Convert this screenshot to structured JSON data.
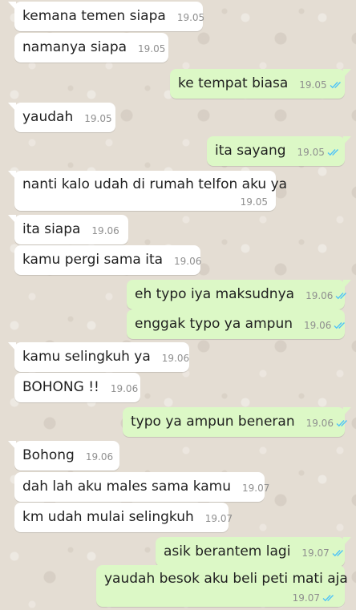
{
  "chat": {
    "messages": [
      {
        "text": "kemana temen siapa",
        "time": "19.05",
        "direction": "in"
      },
      {
        "text": "namanya siapa",
        "time": "19.05",
        "direction": "in"
      },
      {
        "text": "ke tempat biasa",
        "time": "19.05",
        "direction": "out",
        "status": "read"
      },
      {
        "text": "yaudah",
        "time": "19.05",
        "direction": "in"
      },
      {
        "text": "ita sayang",
        "time": "19.05",
        "direction": "out",
        "status": "read"
      },
      {
        "text": "nanti kalo udah di rumah telfon aku ya",
        "time": "19.05",
        "direction": "in"
      },
      {
        "text": "ita siapa",
        "time": "19.06",
        "direction": "in"
      },
      {
        "text": "kamu pergi sama ita",
        "time": "19.06",
        "direction": "in"
      },
      {
        "text": "eh typo iya maksudnya",
        "time": "19.06",
        "direction": "out",
        "status": "read"
      },
      {
        "text": "enggak typo ya ampun",
        "time": "19.06",
        "direction": "out",
        "status": "read"
      },
      {
        "text": "kamu selingkuh ya",
        "time": "19.06",
        "direction": "in"
      },
      {
        "text": "BOHONG !!",
        "time": "19.06",
        "direction": "in"
      },
      {
        "text": "typo ya ampun beneran",
        "time": "19.06",
        "direction": "out",
        "status": "read"
      },
      {
        "text": "Bohong",
        "time": "19.06",
        "direction": "in"
      },
      {
        "text": "dah lah aku males sama kamu",
        "time": "19.07",
        "direction": "in"
      },
      {
        "text": "km udah mulai selingkuh",
        "time": "19.07",
        "direction": "in"
      },
      {
        "text": "asik berantem lagi",
        "time": "19.07",
        "direction": "out",
        "status": "read"
      },
      {
        "text": "yaudah besok aku beli peti mati aja",
        "time": "19.07",
        "direction": "out",
        "status": "read"
      }
    ]
  },
  "colors": {
    "wallpaper": "#e4ddd3",
    "incoming_bubble": "#ffffff",
    "outgoing_bubble": "#dcf8c6",
    "timestamp": "#8f8f8f",
    "read_ticks": "#4fc3f7"
  },
  "icons": {
    "read_receipt": "double-check-icon"
  }
}
